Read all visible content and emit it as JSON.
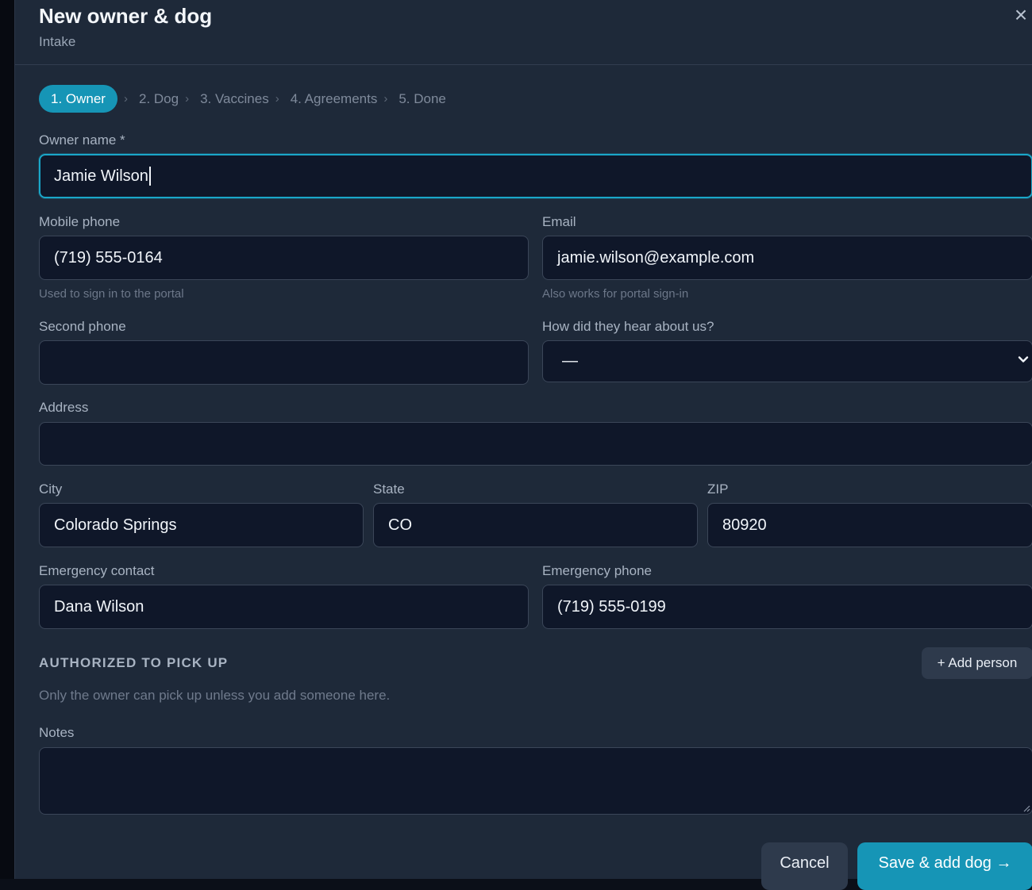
{
  "header": {
    "title": "New owner & dog",
    "subtitle": "Intake",
    "close_icon": "close-icon",
    "close_glyph": "×"
  },
  "steps": [
    {
      "label": "1. Owner",
      "active": true
    },
    {
      "label": "2. Dog",
      "active": false
    },
    {
      "label": "3. Vaccines",
      "active": false
    },
    {
      "label": "4. Agreements",
      "active": false
    },
    {
      "label": "5. Done",
      "active": false
    }
  ],
  "step_separator": "›",
  "form": {
    "owner_name": {
      "label": "Owner name *",
      "value": "Jamie Wilson"
    },
    "mobile_phone": {
      "label": "Mobile phone",
      "value": "(719) 555-0164",
      "help": "Used to sign in to the portal"
    },
    "email": {
      "label": "Email",
      "value": "jamie.wilson@example.com",
      "help": "Also works for portal sign-in"
    },
    "second_phone": {
      "label": "Second phone",
      "value": ""
    },
    "referral": {
      "label": "How did they hear about us?",
      "selected": "—"
    },
    "address": {
      "label": "Address",
      "value": ""
    },
    "city": {
      "label": "City",
      "value": "Colorado Springs"
    },
    "state": {
      "label": "State",
      "value": "CO"
    },
    "zip": {
      "label": "ZIP",
      "value": "80920"
    },
    "emergency_contact": {
      "label": "Emergency contact",
      "value": "Dana Wilson"
    },
    "emergency_phone": {
      "label": "Emergency phone",
      "value": "(719) 555-0199"
    },
    "notes": {
      "label": "Notes",
      "value": ""
    }
  },
  "pickup": {
    "heading": "AUTHORIZED TO PICK UP",
    "add_button": "+ Add person",
    "help": "Only the owner can pick up unless you add someone here."
  },
  "footer": {
    "cancel": "Cancel",
    "save": "Save & add dog →"
  },
  "colors": {
    "accent": "#1695b6",
    "modal_bg": "#1e2939",
    "field_bg": "#0f1729",
    "focus_border": "#1aa6c8"
  }
}
